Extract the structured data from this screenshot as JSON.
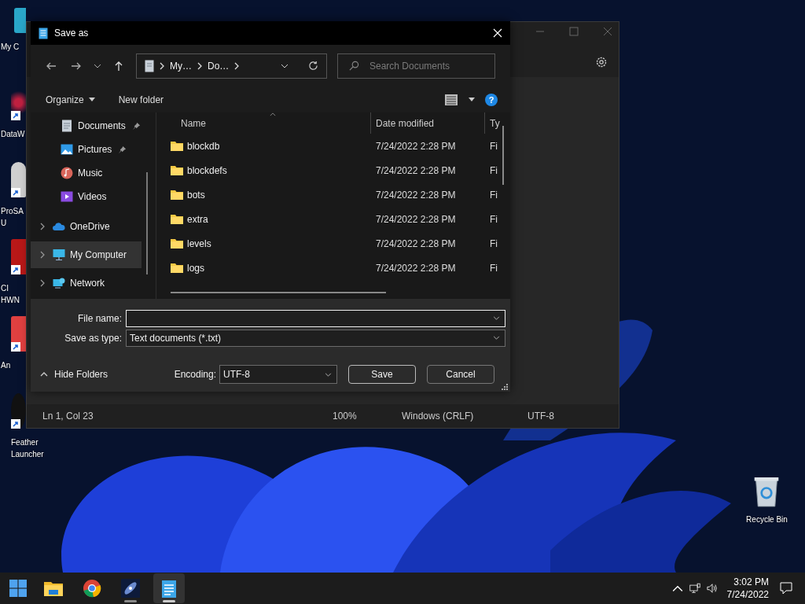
{
  "desktop": {
    "icons": [
      {
        "kind": "computer",
        "shortcut": false,
        "lines": [
          "My C"
        ]
      },
      {
        "kind": "web",
        "shortcut": true,
        "lines": [
          "DataW"
        ]
      },
      {
        "kind": "person",
        "shortcut": true,
        "lines": [
          "ProSA",
          "U"
        ]
      },
      {
        "kind": "red",
        "shortcut": true,
        "lines": [
          "CI",
          "HWN"
        ]
      },
      {
        "kind": "arrow",
        "shortcut": true,
        "lines": [
          "An"
        ]
      },
      {
        "kind": "feather",
        "shortcut": true,
        "lines": [
          "Feather",
          "Launcher"
        ]
      }
    ],
    "recycle_bin": {
      "label": "Recycle Bin"
    }
  },
  "notepad": {
    "status_bar": {
      "position": "Ln 1, Col 23",
      "zoom": "100%",
      "line_ending": "Windows (CRLF)",
      "encoding": "UTF-8"
    }
  },
  "dialog": {
    "title": "Save as",
    "breadcrumb": [
      "My…",
      "Do…"
    ],
    "search": {
      "placeholder": "Search Documents"
    },
    "toolbar": {
      "organize": "Organize",
      "new_folder": "New folder"
    },
    "nav": [
      {
        "label": "Documents",
        "kind": "documents",
        "pinned": true,
        "expandable": false,
        "selected": false
      },
      {
        "label": "Pictures",
        "kind": "pictures",
        "pinned": true,
        "expandable": false,
        "selected": false
      },
      {
        "label": "Music",
        "kind": "music",
        "pinned": false,
        "expandable": false,
        "selected": false
      },
      {
        "label": "Videos",
        "kind": "videos",
        "pinned": false,
        "expandable": false,
        "selected": false
      },
      {
        "label": "OneDrive",
        "kind": "cloud",
        "pinned": false,
        "expandable": true,
        "selected": false
      },
      {
        "label": "My Computer",
        "kind": "computer",
        "pinned": false,
        "expandable": true,
        "selected": true
      },
      {
        "label": "Network",
        "kind": "network",
        "pinned": false,
        "expandable": true,
        "selected": false
      }
    ],
    "table": {
      "columns": [
        "Name",
        "Date modified",
        "Ty"
      ],
      "rows": [
        {
          "name": "blockdb",
          "date": "7/24/2022 2:28 PM",
          "type": "Fi"
        },
        {
          "name": "blockdefs",
          "date": "7/24/2022 2:28 PM",
          "type": "Fi"
        },
        {
          "name": "bots",
          "date": "7/24/2022 2:28 PM",
          "type": "Fi"
        },
        {
          "name": "extra",
          "date": "7/24/2022 2:28 PM",
          "type": "Fi"
        },
        {
          "name": "levels",
          "date": "7/24/2022 2:28 PM",
          "type": "Fi"
        },
        {
          "name": "logs",
          "date": "7/24/2022 2:28 PM",
          "type": "Fi"
        }
      ]
    },
    "file_name": {
      "label": "File name:"
    },
    "save_type": {
      "label": "Save as type:",
      "value": "Text documents (*.txt)"
    },
    "help": "?",
    "hide_folders": "Hide Folders",
    "encoding": {
      "label": "Encoding:",
      "value": "UTF-8"
    },
    "buttons": {
      "save": "Save",
      "cancel": "Cancel"
    }
  },
  "taskbar": {
    "apps": [
      {
        "kind": "explorer",
        "running": false,
        "active": false
      },
      {
        "kind": "chrome",
        "running": false,
        "active": false
      },
      {
        "kind": "galaxy",
        "running": true,
        "active": false
      },
      {
        "kind": "notepad",
        "running": true,
        "active": true
      }
    ],
    "clock": {
      "time": "3:02 PM",
      "date": "7/24/2022"
    }
  }
}
